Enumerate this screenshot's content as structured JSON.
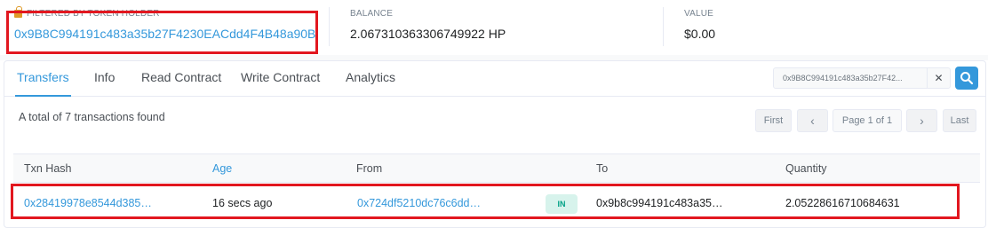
{
  "summary": {
    "filtered_label": "FILTERED BY TOKEN HOLDER",
    "filtered_address": "0x9B8C994191c483a35b27F4230EACdd4F4B48a90B",
    "balance_label": "BALANCE",
    "balance_value": "2.067310363306749922 HP",
    "value_label": "VALUE",
    "value_value": "$0.00"
  },
  "tabs": [
    {
      "label": "Transfers",
      "active": true
    },
    {
      "label": "Info",
      "active": false
    },
    {
      "label": "Read Contract",
      "active": false
    },
    {
      "label": "Write Contract",
      "active": false
    },
    {
      "label": "Analytics",
      "active": false
    }
  ],
  "search": {
    "value": "0x9B8C994191c483a35b27F42...",
    "clear_glyph": "✕"
  },
  "found_text": "A total of 7 transactions found",
  "pagination": {
    "first": "First",
    "prev": "‹",
    "page": "Page 1 of 1",
    "next": "›",
    "last": "Last"
  },
  "table": {
    "headers": {
      "txn_hash": "Txn Hash",
      "age": "Age",
      "from": "From",
      "to": "To",
      "quantity": "Quantity"
    },
    "rows": [
      {
        "txn_hash": "0x28419978e8544d385…",
        "age": "16 secs ago",
        "from": "0x724df5210dc76c6dd…",
        "direction": "IN",
        "to": "0x9b8c994191c483a35…",
        "quantity": "2.05228616710684631"
      }
    ]
  },
  "colors": {
    "accent": "#3498db",
    "highlight": "#e2171f",
    "in_badge_bg": "#d7f3ec",
    "in_badge_text": "#00a186"
  }
}
